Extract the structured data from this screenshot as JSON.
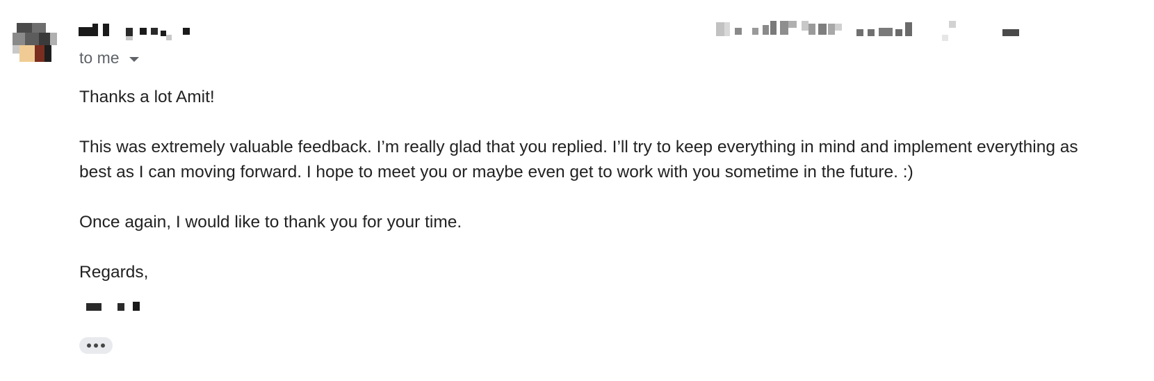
{
  "message": {
    "recipient_label": "to me",
    "body": {
      "greeting": "Thanks a lot Amit!",
      "paragraph_line_1": "This was extremely valuable feedback. I’m really glad that you replied. I’ll try to keep everything in mind and implement everything as",
      "paragraph_line_2": "best as I can moving forward. I hope to meet you or maybe even get to work with you sometime in the future. :)",
      "thanks": "Once again, I would like to thank you for your time.",
      "closing": "Regards,"
    }
  },
  "icons": {
    "recipient_details": "chevron-down-icon",
    "show_trimmed_content": "more-horizontal-icon"
  },
  "colors": {
    "text": "#222222",
    "secondary_text": "#5f6368",
    "chip_background": "#e8eaed"
  }
}
